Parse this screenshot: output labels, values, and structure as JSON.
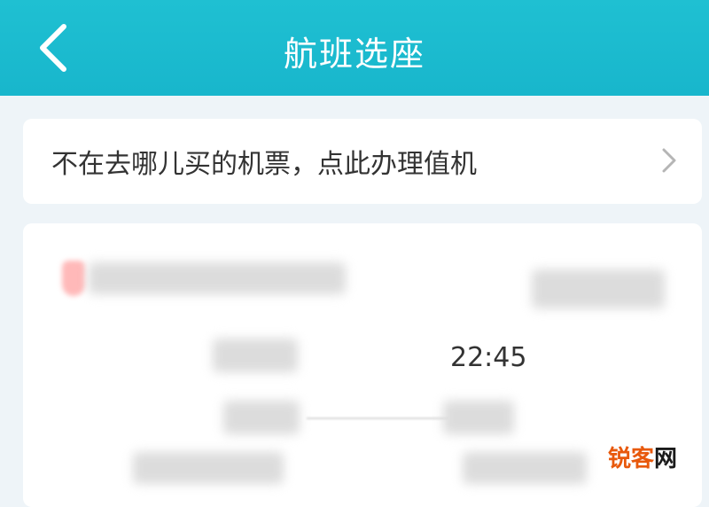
{
  "header": {
    "title": "航班选座",
    "back_icon": "chevron-left-icon",
    "background_color": "#1cbcd0"
  },
  "banner": {
    "text": "不在去哪儿买的机票，点此办理值机",
    "arrow_icon": "chevron-right-icon"
  },
  "flight_card": {
    "arrival_time": "22:45"
  },
  "watermark": {
    "part1": "锐客",
    "part2": "网"
  }
}
